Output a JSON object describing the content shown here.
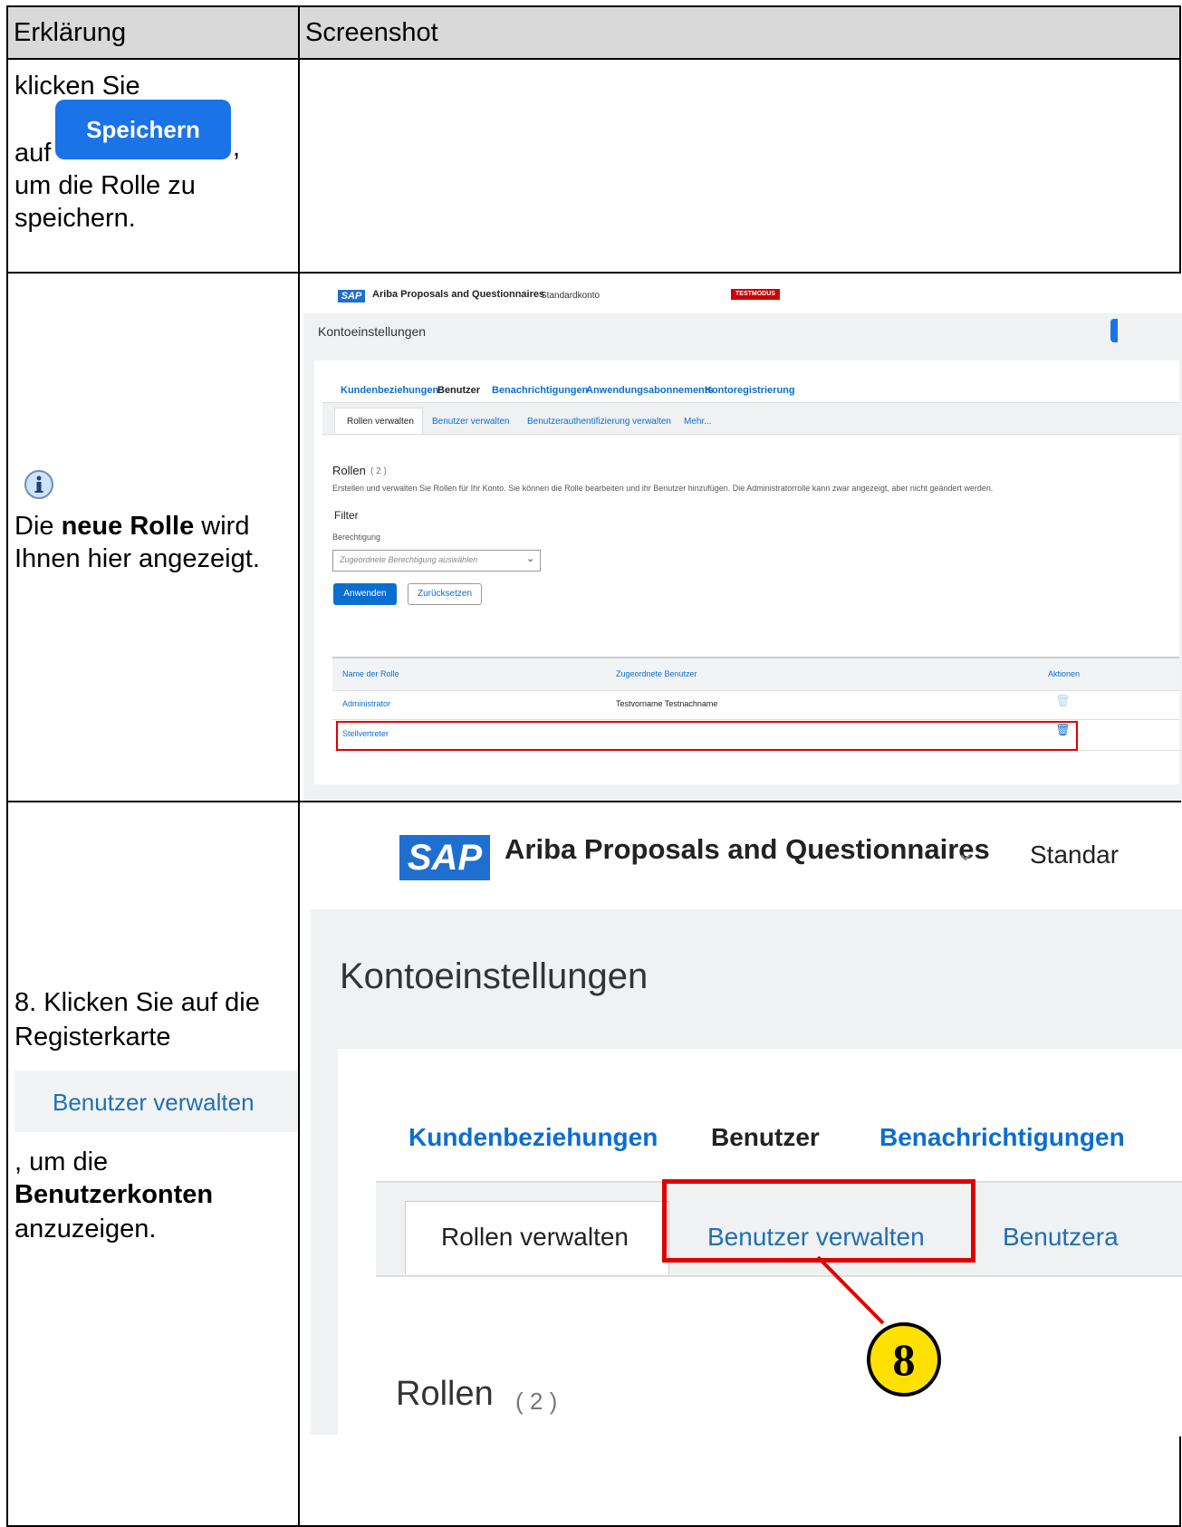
{
  "headers": {
    "explanation": "Erklärung",
    "screenshot": "Screenshot"
  },
  "row1": {
    "line1": "klicken Sie",
    "auf": "auf",
    "button": "Speichern",
    "comma": ",",
    "line3": "um die Rolle zu",
    "line4": "speichern."
  },
  "row2": {
    "text_pre": "Die ",
    "text_bold": "neue Rolle",
    "text_post": " wird",
    "text_line2": "Ihnen hier angezeigt.",
    "shot": {
      "logo": "SAP",
      "app_name": "Ariba Proposals and Questionnaires",
      "account": "Standardkonto",
      "mode_badge": "TESTMODUS",
      "page_title": "Kontoeinstellungen",
      "tabs": [
        "Kundenbeziehungen",
        "Benutzer",
        "Benachrichtigungen",
        "Anwendungsabonnements",
        "Kontoregistrierung"
      ],
      "subtabs": [
        "Rollen verwalten",
        "Benutzer verwalten",
        "Benutzerauthentifizierung verwalten",
        "Mehr..."
      ],
      "section_title": "Rollen",
      "section_count": "( 2 )",
      "description": "Erstellen und verwalten Sie Rollen für Ihr Konto. Sie können die Rolle bearbeiten und ihr Benutzer hinzufügen. Die Administratorrolle kann zwar angezeigt, aber nicht geändert werden.",
      "filter_label": "Filter",
      "permission_label": "Berechtigung",
      "permission_placeholder": "Zugeordnete Berechtigung auswählen",
      "apply_button": "Anwenden",
      "reset_button": "Zurücksetzen",
      "table_headers": [
        "Name der Rolle",
        "Zugeordnete Benutzer",
        "Aktionen"
      ],
      "rows": [
        {
          "name": "Administrator",
          "users": "Testvorname Testnachname"
        },
        {
          "name": "Stellvertreter",
          "users": ""
        }
      ]
    }
  },
  "row3": {
    "line1": "8. Klicken Sie auf die",
    "line2": "Registerkarte",
    "tab_image": "Benutzer verwalten",
    "line3": ", um die",
    "line4_bold": "Benutzerkonten",
    "line5": "anzuzeigen.",
    "shot": {
      "logo": "SAP",
      "app_name": "Ariba Proposals and Questionnaires",
      "account_partial": "Standar",
      "page_title": "Kontoeinstellungen",
      "tabs": [
        "Kundenbeziehungen",
        "Benutzer",
        "Benachrichtigungen"
      ],
      "subtabs": [
        "Rollen verwalten",
        "Benutzer verwalten",
        "Benutzera"
      ],
      "callout": "8",
      "section_title": "Rollen",
      "section_count": "( 2 )"
    }
  }
}
